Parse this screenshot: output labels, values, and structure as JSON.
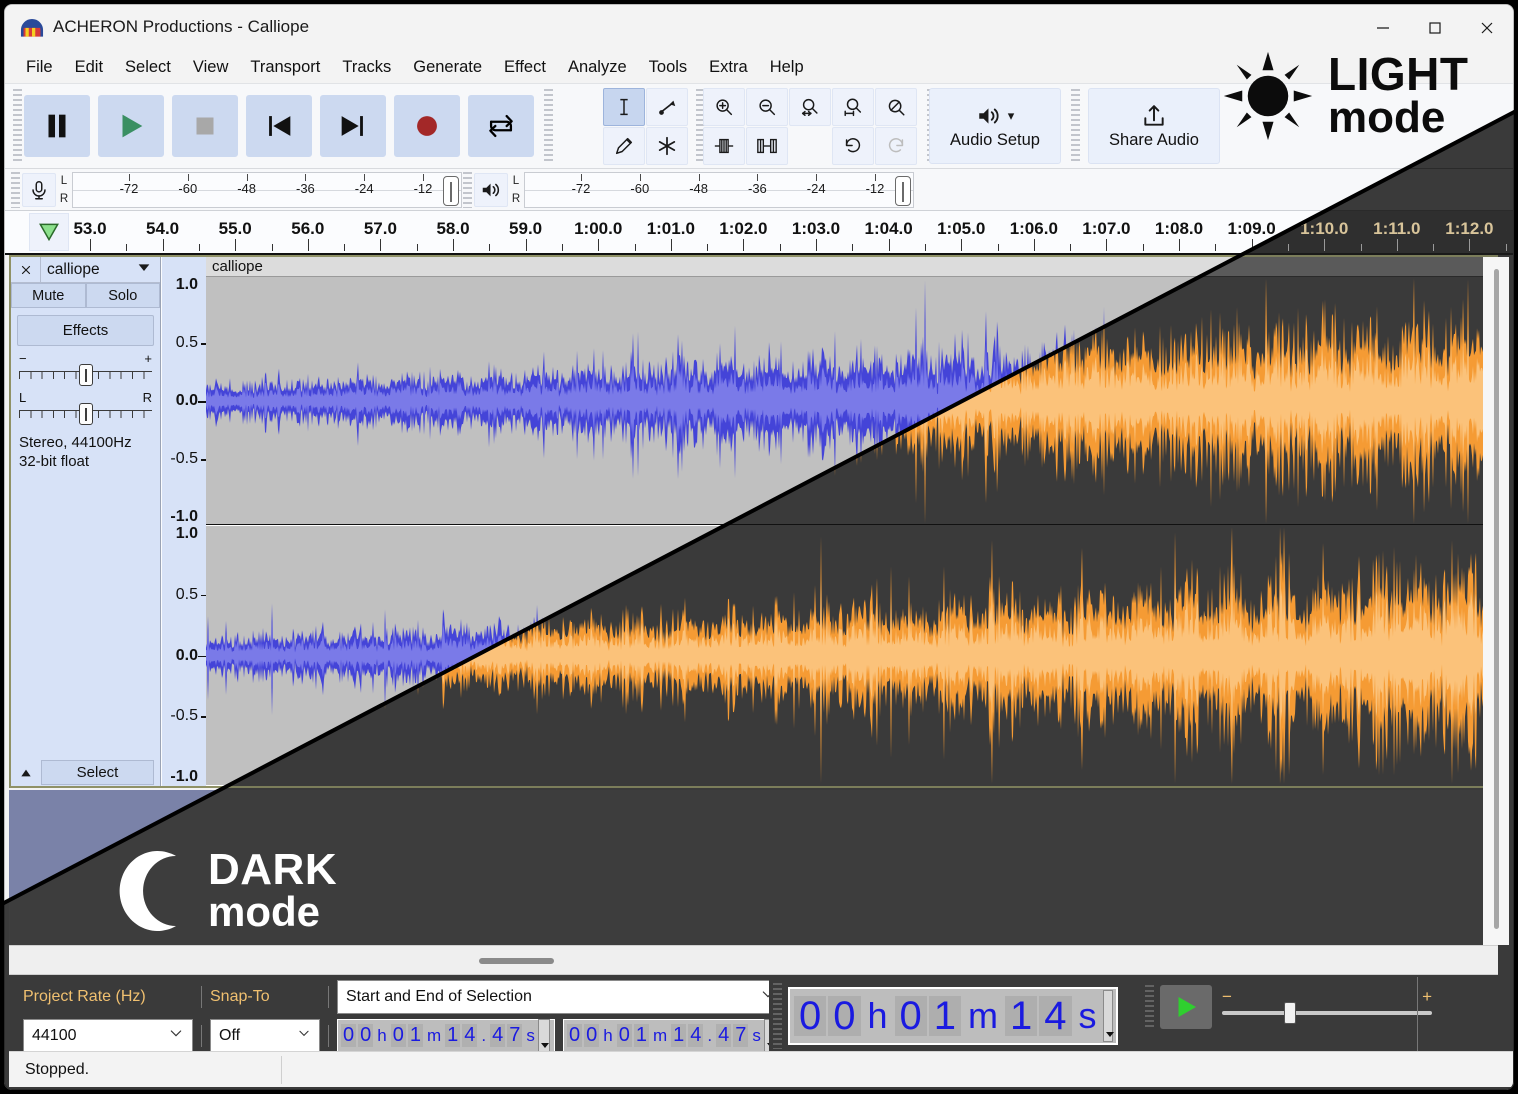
{
  "window": {
    "title": "ACHERON Productions - Calliope",
    "app_icon": "headphones-icon",
    "minimize": "—",
    "maximize": "☐",
    "close": "✕"
  },
  "menu": {
    "items": [
      "File",
      "Edit",
      "Select",
      "View",
      "Transport",
      "Tracks",
      "Generate",
      "Effect",
      "Analyze",
      "Tools",
      "Extra",
      "Help"
    ]
  },
  "transport": {
    "buttons": [
      {
        "name": "pause-button",
        "icon": "pause-icon"
      },
      {
        "name": "play-button",
        "icon": "play-icon"
      },
      {
        "name": "stop-button",
        "icon": "stop-icon"
      },
      {
        "name": "skip-to-start-button",
        "icon": "skip-start-icon"
      },
      {
        "name": "skip-to-end-button",
        "icon": "skip-end-icon"
      },
      {
        "name": "record-button",
        "icon": "record-icon"
      },
      {
        "name": "loop-button",
        "icon": "loop-icon"
      }
    ]
  },
  "tools": {
    "row1": [
      {
        "name": "selection-tool",
        "icon": "i-beam-icon",
        "selected": true
      },
      {
        "name": "envelope-tool",
        "icon": "envelope-icon",
        "selected": false
      }
    ],
    "row2": [
      {
        "name": "draw-tool",
        "icon": "pencil-icon",
        "selected": false
      },
      {
        "name": "multi-tool",
        "icon": "asterisk-icon",
        "selected": false
      }
    ]
  },
  "edit_tools": {
    "row1": [
      {
        "name": "zoom-in-button",
        "icon": "zoom-in-icon"
      },
      {
        "name": "zoom-out-button",
        "icon": "zoom-out-icon"
      },
      {
        "name": "fit-selection-button",
        "icon": "fit-selection-icon"
      },
      {
        "name": "fit-project-button",
        "icon": "fit-project-icon"
      },
      {
        "name": "zoom-toggle-button",
        "icon": "zoom-toggle-icon"
      }
    ],
    "row2": [
      {
        "name": "trim-audio-button",
        "icon": "trim-icon"
      },
      {
        "name": "silence-audio-button",
        "icon": "silence-icon"
      },
      {
        "name": "spacer",
        "icon": "none"
      },
      {
        "name": "undo-button",
        "icon": "undo-icon"
      },
      {
        "name": "redo-button",
        "icon": "redo-icon"
      }
    ]
  },
  "audio_setup": {
    "label": "Audio Setup",
    "icon": "speaker-icon",
    "dropdown": "▾"
  },
  "share_audio": {
    "label": "Share Audio",
    "icon": "upload-icon"
  },
  "meters": {
    "record": {
      "icon": "microphone-icon",
      "channels": [
        "L",
        "R"
      ],
      "ticks": [
        "-72",
        "-60",
        "-48",
        "-36",
        "-24",
        "-12"
      ]
    },
    "playback": {
      "icon": "speaker-icon",
      "channels": [
        "L",
        "R"
      ],
      "ticks": [
        "-72",
        "-60",
        "-48",
        "-36",
        "-24",
        "-12"
      ]
    }
  },
  "timeline": {
    "pin_icon": "pinned-play-head-icon",
    "labels": [
      "53.0",
      "54.0",
      "55.0",
      "56.0",
      "57.0",
      "58.0",
      "59.0",
      "1:00.0",
      "1:01.0",
      "1:02.0",
      "1:03.0",
      "1:04.0",
      "1:05.0",
      "1:06.0",
      "1:07.0",
      "1:08.0",
      "1:09.0",
      "1:10.0",
      "1:11.0",
      "1:12.0"
    ]
  },
  "track": {
    "close_icon": "close-icon",
    "name": "calliope",
    "dropdown_icon": "chevron-down-icon",
    "mute_label": "Mute",
    "solo_label": "Solo",
    "effects_label": "Effects",
    "gain_slider": {
      "min_label": "−",
      "max_label": "+",
      "name": "gain-slider"
    },
    "pan_slider": {
      "min_label": "L",
      "max_label": "R",
      "name": "pan-slider"
    },
    "info_line1": "Stereo, 44100Hz",
    "info_line2": "32-bit float",
    "select_label": "Select",
    "collapse_icon": "triangle-up-icon",
    "clip_name": "calliope",
    "vertical_ruler_labels": [
      "1.0",
      "0.5",
      "0.0",
      "-0.5",
      "-1.0"
    ]
  },
  "selection_toolbar": {
    "project_rate_label": "Project Rate (Hz)",
    "project_rate_value": "44100",
    "snap_to_label": "Snap-To",
    "snap_to_value": "Off",
    "selection_mode": "Start and End of Selection",
    "start_time": "00h01m14.47s",
    "end_time": "00h01m14.47s"
  },
  "time_display": {
    "value": "00h01m14s"
  },
  "play_speed": {
    "play_icon": "play-icon",
    "min_label": "−",
    "max_label": "+",
    "name": "play-speed-slider"
  },
  "status_bar": {
    "message": "Stopped."
  },
  "badges": {
    "light": {
      "title": "LIGHT",
      "subtitle": "mode",
      "icon": "sun-icon"
    },
    "dark": {
      "title": "DARK",
      "subtitle": "mode",
      "icon": "moon-icon"
    }
  },
  "colors": {
    "light_waveform": "#4444d8",
    "light_waveform_rms": "#7a7ae8",
    "light_track_bg": "#c0c0c0",
    "dark_waveform": "#f59b34",
    "dark_waveform_rms": "#fbc27a",
    "dark_track_bg": "#3a3a3a",
    "light_ui_bg": "#f3f3f3",
    "dark_ui_bg": "#3a3a3a",
    "track_border": "#8f9166",
    "selection_digit": "#1a1ae0"
  }
}
